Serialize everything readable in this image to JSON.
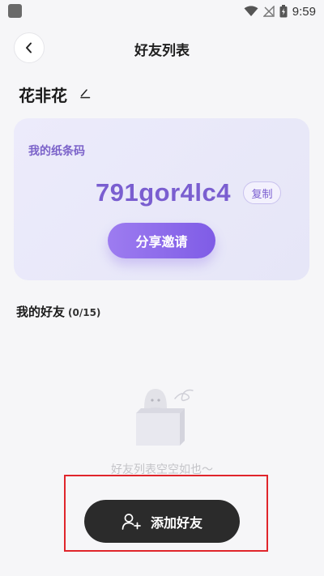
{
  "status_bar": {
    "time": "9:59",
    "icons": [
      "app-square-icon",
      "wifi-icon",
      "no-signal-icon",
      "battery-charging-icon"
    ]
  },
  "header": {
    "back_icon": "chevron-left-icon",
    "title": "好友列表"
  },
  "profile": {
    "nickname": "花非花",
    "edit_icon": "pencil-icon"
  },
  "code_card": {
    "label": "我的纸条码",
    "code": "791gor4lc4",
    "copy_label": "复制",
    "share_label": "分享邀请"
  },
  "friends": {
    "title": "我的好友",
    "count": "(0/15)",
    "empty_text": "好友列表空空如也～",
    "illustration": "ghost-in-box-icon"
  },
  "add_friend": {
    "icon": "add-user-icon",
    "label": "添加好友"
  },
  "colors": {
    "accent": "#7a5ed0",
    "card_bg": "#ecebfb",
    "dark_button": "#2b2b2b",
    "highlight": "#e0252b"
  }
}
